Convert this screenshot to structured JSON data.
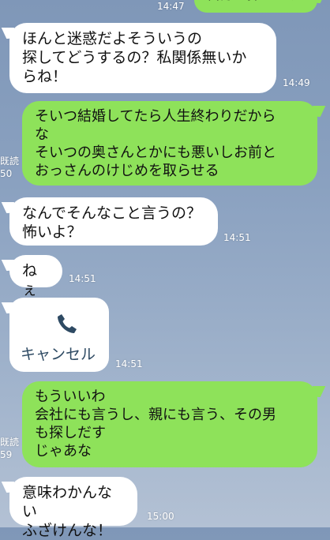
{
  "top_partial": {
    "text": "自分で探します",
    "time": "14:47"
  },
  "messages": [
    {
      "side": "left",
      "text": "ほんと迷惑だよそういうの\n探してどうするの？私関係無いか\nらね！",
      "time": "14:49"
    },
    {
      "side": "right",
      "text": "そいつ結婚してたら人生終わりだから\nな\nそいつの奥さんとかにも悪いしお前と\nおっさんのけじめを取らせる",
      "read": "既読",
      "time": "50"
    },
    {
      "side": "left",
      "text": "なんでそんなこと言うの？\n怖いよ？",
      "time": "14:51"
    },
    {
      "side": "left",
      "text": "ねぇ",
      "time": "14:51"
    },
    {
      "side": "left",
      "type": "call",
      "text": "キャンセル",
      "time": "14:51"
    },
    {
      "side": "right",
      "text": "もういいわ\n会社にも言うし、親にも言う、その男\nも探しだす\nじゃあな",
      "read": "既読",
      "time": "59"
    },
    {
      "side": "left",
      "text": "意味わかんない\nふざけんな！",
      "time": "15:00"
    }
  ],
  "icons": {
    "call": "phone-icon"
  },
  "colors": {
    "left_bubble": "#ffffff",
    "right_bubble": "#8ee25a",
    "background": "#8aa1c0"
  }
}
